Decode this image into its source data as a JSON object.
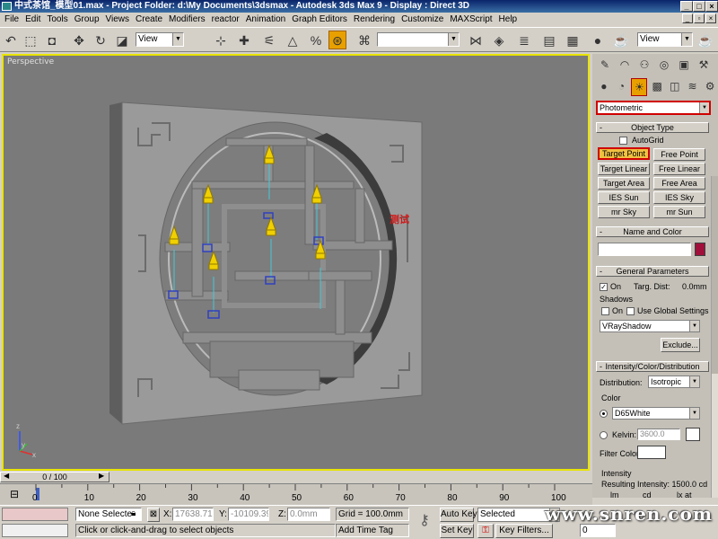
{
  "window": {
    "title": "中式茶馆_模型01.max   - Project Folder: d:\\My Documents\\3dsmax   - Autodesk 3ds Max 9   - Display : Direct 3D",
    "min": "_",
    "max": "□",
    "close": "×"
  },
  "menu": [
    "File",
    "Edit",
    "Tools",
    "Group",
    "Views",
    "Create",
    "Modifiers",
    "reactor",
    "Animation",
    "Graph Editors",
    "Rendering",
    "Customize",
    "MAXScript",
    "Help"
  ],
  "toolbar": {
    "refcoord": "View",
    "named_selection": "",
    "render_view": "View"
  },
  "viewport": {
    "label": "Perspective",
    "annotation": "测试",
    "axis": {
      "x": "x",
      "y": "y",
      "z": "z"
    }
  },
  "panel": {
    "dropdown": "Photometric",
    "object_type": {
      "header": "Object Type",
      "autogrid": "AutoGrid",
      "buttons": [
        "Target Point",
        "Free Point",
        "Target Linear",
        "Free Linear",
        "Target Area",
        "Free Area",
        "IES Sun",
        "IES Sky",
        "mr Sky",
        "mr Sun"
      ]
    },
    "name_color": {
      "header": "Name and Color",
      "name": ""
    },
    "general": {
      "header": "General Parameters",
      "on": "On",
      "targ_dist": "Targ. Dist:",
      "targ_dist_value": "0.0mm",
      "shadows": "Shadows",
      "shadows_on": "On",
      "use_global": "Use Global Settings",
      "shadow_type": "VRayShadow",
      "exclude": "Exclude..."
    },
    "intensity": {
      "header": "Intensity/Color/Distribution",
      "distribution_label": "Distribution:",
      "distribution": "Isotropic",
      "color_label": "Color",
      "preset": "D65White",
      "kelvin_label": "Kelvin:",
      "kelvin_value": "3600.0",
      "filter_color": "Filter Color:",
      "intensity_label": "Intensity",
      "resulting": "Resulting Intensity: 1500.0 cd",
      "lm": "lm",
      "cd": "cd",
      "lx": "lx at"
    }
  },
  "timeline": {
    "frame": "0 / 100",
    "ticks": [
      "0",
      "10",
      "20",
      "30",
      "40",
      "50",
      "60",
      "70",
      "80",
      "90",
      "100"
    ]
  },
  "status": {
    "selection": "None Selecte",
    "x_label": "X:",
    "x": "17638.713",
    "y_label": "Y:",
    "y": "-10109.395",
    "z_label": "Z:",
    "z": "0.0mm",
    "grid": "Grid = 100.0mm",
    "prompt": "Click or click-and-drag to select objects",
    "add_time_tag": "Add Time Tag",
    "auto_key": "Auto Key",
    "set_key": "Set Key",
    "selected": "Selected",
    "key_filters": "Key Filters...",
    "frame_field": "0"
  },
  "watermark": "www.snren.com",
  "colors": {
    "viewport_border": "#e8e400",
    "light_yellow": "#f0d000",
    "swatch": "#a0103a"
  }
}
